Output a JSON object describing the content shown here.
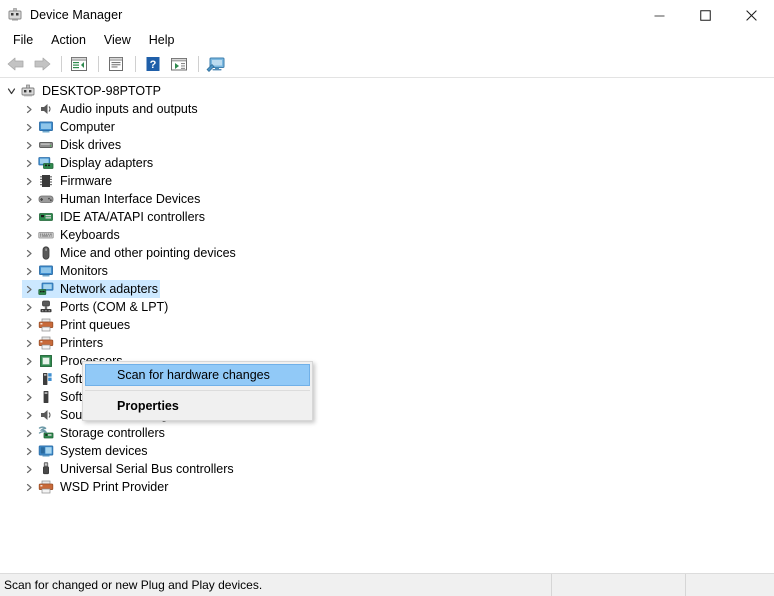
{
  "window": {
    "title": "Device Manager",
    "icon": "device-manager-icon",
    "controls": [
      {
        "name": "minimize-button",
        "glyph": "minimize"
      },
      {
        "name": "maximize-button",
        "glyph": "maximize"
      },
      {
        "name": "close-button",
        "glyph": "close"
      }
    ]
  },
  "menubar": {
    "items": [
      {
        "label": "File"
      },
      {
        "label": "Action"
      },
      {
        "label": "View"
      },
      {
        "label": "Help"
      }
    ]
  },
  "toolbar": {
    "buttons": [
      {
        "name": "back-button",
        "icon": "back-arrow-icon",
        "enabled": false
      },
      {
        "name": "forward-button",
        "icon": "forward-arrow-icon",
        "enabled": false
      },
      {
        "name": "show-hide-console-tree-button",
        "icon": "console-tree-icon",
        "enabled": true
      },
      {
        "name": "properties-button",
        "icon": "properties-icon",
        "enabled": true
      },
      {
        "name": "help-button",
        "icon": "help-question-icon",
        "enabled": true
      },
      {
        "name": "update-driver-button",
        "icon": "update-driver-icon",
        "enabled": true
      },
      {
        "name": "scan-for-hardware-changes-button",
        "icon": "scan-hardware-icon",
        "enabled": true
      }
    ]
  },
  "tree": {
    "root": {
      "label": "DESKTOP-98PTOTP",
      "icon": "computer-root-icon",
      "expanded": true
    },
    "nodes": [
      {
        "label": "Audio inputs and outputs",
        "icon": "speaker-icon"
      },
      {
        "label": "Computer",
        "icon": "monitor-icon"
      },
      {
        "label": "Disk drives",
        "icon": "disk-drive-icon"
      },
      {
        "label": "Display adapters",
        "icon": "display-adapter-icon"
      },
      {
        "label": "Firmware",
        "icon": "firmware-chip-icon"
      },
      {
        "label": "Human Interface Devices",
        "icon": "gamepad-icon"
      },
      {
        "label": "IDE ATA/ATAPI controllers",
        "icon": "ide-controller-icon"
      },
      {
        "label": "Keyboards",
        "icon": "keyboard-icon"
      },
      {
        "label": "Mice and other pointing devices",
        "icon": "mouse-icon"
      },
      {
        "label": "Monitors",
        "icon": "monitor-icon"
      },
      {
        "label": "Network adapters",
        "icon": "network-adapter-icon",
        "selected": true
      },
      {
        "label": "Ports (COM & LPT)",
        "icon": "port-icon"
      },
      {
        "label": "Print queues",
        "icon": "printer-icon"
      },
      {
        "label": "Printers",
        "icon": "printer-icon"
      },
      {
        "label": "Processors",
        "icon": "processor-icon"
      },
      {
        "label": "Software components",
        "icon": "software-component-icon"
      },
      {
        "label": "Software devices",
        "icon": "software-device-icon"
      },
      {
        "label": "Sound, video and game controllers",
        "icon": "speaker-icon"
      },
      {
        "label": "Storage controllers",
        "icon": "storage-controller-icon"
      },
      {
        "label": "System devices",
        "icon": "system-device-icon"
      },
      {
        "label": "Universal Serial Bus controllers",
        "icon": "usb-controller-icon"
      },
      {
        "label": "WSD Print Provider",
        "icon": "printer-icon"
      }
    ]
  },
  "context_menu": {
    "items": [
      {
        "label": "Scan for hardware changes",
        "highlighted": true,
        "bold": false
      },
      {
        "label": "Properties",
        "highlighted": false,
        "bold": true
      }
    ]
  },
  "statusbar": {
    "message": "Scan for changed or new Plug and Play devices.",
    "cell2": "",
    "cell3": ""
  },
  "colors": {
    "selection_blue": "#cce8ff",
    "menu_highlight": "#91c9f7",
    "menu_background": "#f0f0f0",
    "window_background": "#ffffff",
    "statusbar_background": "#f0f0f0"
  }
}
